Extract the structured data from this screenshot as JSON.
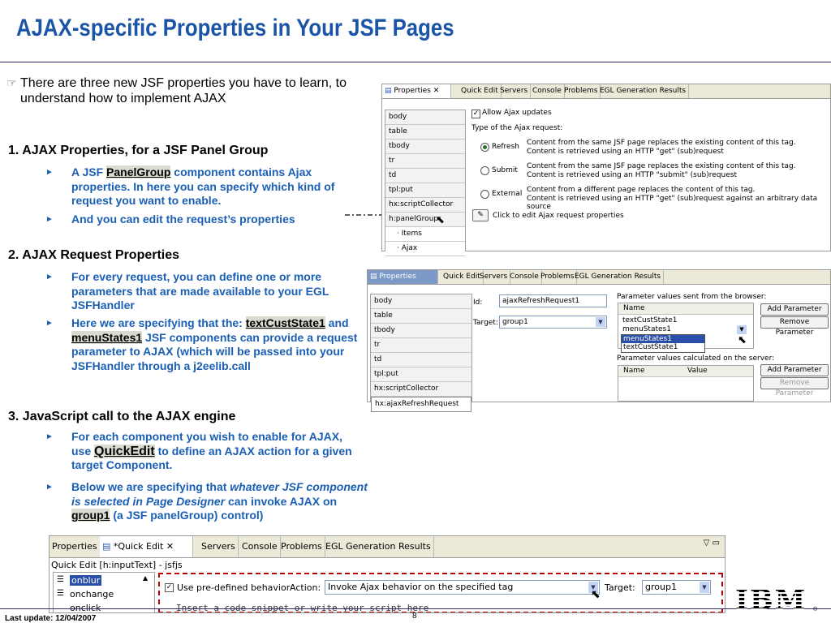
{
  "title": "AJAX-specific Properties in Your JSF Pages",
  "intro": {
    "hand_icon": "pointing-hand-icon",
    "text": "There are three new JSF properties you have to learn, to understand how to implement AJAX"
  },
  "sections": [
    {
      "heading": "1. AJAX Properties, for a JSF Panel Group"
    },
    {
      "heading": "2. AJAX Request Properties"
    },
    {
      "heading": "3. JavaScript call to the AJAX engine"
    }
  ],
  "bullets": {
    "b1_a": "A JSF ",
    "b1_hl": "PanelGroup",
    "b1_b": " component contains Ajax properties.  In here you can specify which kind of request you want to enable.",
    "b2": "And you can edit the request’s properties",
    "b3": "For every request, you can define one or more parameters that are made available to your EGL JSFHandler",
    "b4_a": "Here we are specifying that the: ",
    "b4_hl1": "textCustState1",
    "b4_and": " and ",
    "b4_hl2": "menuStates1",
    "b4_b": " JSF components can provide a request parameter to AJAX (which will be passed into your JSFHandler through a j2eelib.call",
    "b5_a": "For each component you wish to enable for AJAX, use ",
    "b5_hl": "QuickEdit",
    "b5_b": " to define an AJAX action for a given target Component.",
    "b6_a": "Below we are specifying that ",
    "b6_it": "whatever JSF component is selected in Page Designer",
    "b6_b": " can invoke AJAX on ",
    "b6_hl": "group1",
    "b6_c": " (a JSF panelGroup) control)"
  },
  "panel1": {
    "tabs": [
      "Properties",
      "Quick Edit",
      "Servers",
      "Console",
      "Problems",
      "EGL Generation Results"
    ],
    "tree": [
      "body",
      "table",
      "tbody",
      "tr",
      "td",
      "tpl:put",
      "hx:scriptCollector",
      "h:panelGroup",
      "Items",
      "Ajax"
    ],
    "allow_label": "Allow Ajax updates",
    "type_label": "Type of the Ajax request:",
    "options": [
      {
        "label": "Refresh",
        "line1": "Content from the same JSF page replaces the existing content of this tag.",
        "line2": "Content is retrieved using an HTTP \"get\" (sub)request"
      },
      {
        "label": "Submit",
        "line1": "Content from the same JSF page replaces the existing content of this tag.",
        "line2": "Content is retrieved using an HTTP \"submit\" (sub)request"
      },
      {
        "label": "External",
        "line1": "Content from a different page replaces the content of this tag.",
        "line2": "Content is retrieved using an HTTP \"get\" (sub)request against an arbitrary data source"
      }
    ],
    "edit_label": "Click to edit Ajax request properties"
  },
  "panel2": {
    "tabs": [
      "Properties",
      "Quick Edit",
      "Servers",
      "Console",
      "Problems",
      "EGL Generation Results"
    ],
    "tree": [
      "body",
      "table",
      "tbody",
      "tr",
      "td",
      "tpl:put",
      "hx:scriptCollector",
      "hx:ajaxRefreshRequest"
    ],
    "id_label": "Id:",
    "id_value": "ajaxRefreshRequest1",
    "target_label": "Target:",
    "target_value": "group1",
    "browser_label": "Parameter values sent from the browser:",
    "server_label": "Parameter values calculated on the server:",
    "name_col": "Name",
    "value_col": "Value",
    "browser_rows": [
      "textCustState1",
      "menuStates1"
    ],
    "dropdown_items": [
      "menuStates1",
      "textCustState1"
    ],
    "add_param": "Add Parameter",
    "remove_param": "Remove Parameter"
  },
  "panel3": {
    "tabs": [
      "Properties",
      "*Quick Edit",
      "Servers",
      "Console",
      "Problems",
      "EGL Generation Results"
    ],
    "header": "Quick Edit [h:inputText] - jsfjs",
    "events": [
      "onblur",
      "onchange",
      "onclick"
    ],
    "use_predefined": "Use pre-defined behavior",
    "action_label": "Action:",
    "action_value": "Invoke Ajax behavior on the specified tag",
    "target_label": "Target:",
    "target_value": "group1",
    "code_hint": "Insert a code snippet or write your script here"
  },
  "footer": {
    "last_update": "Last update: 12/04/2007",
    "page": "8",
    "logo": "IBM"
  },
  "colors": {
    "title": "#1b55a8",
    "bullet": "#1a5fb4",
    "highlight_border": "#c00000"
  }
}
